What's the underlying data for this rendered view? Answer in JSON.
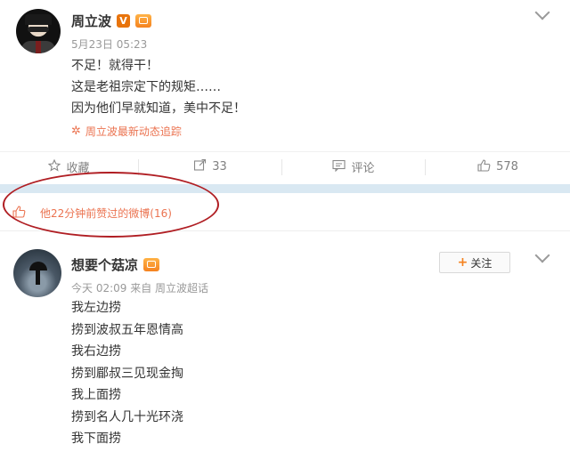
{
  "post1": {
    "author": "周立波",
    "time": "5月23日 05:23",
    "lines": [
      "不足！就得干！",
      "这是老祖宗定下的规矩……",
      "因为他们早就知道，美中不足！"
    ],
    "trace_link": "周立波最新动态追踪",
    "actions": {
      "favorite": "收藏",
      "repost": "33",
      "comment": "评论",
      "like": "578"
    }
  },
  "like_notice": "他22分钟前赞过的微博(16)",
  "post2": {
    "author": "想要个菇凉",
    "follow_label": "关注",
    "meta": "今天 02:09 来自 周立波超话",
    "lines": [
      "我左边捞",
      "捞到波叔五年恩情高",
      "我右边捞",
      "捞到郿叔三见现金掏",
      "我上面捞",
      "捞到名人几十光环浇",
      "我下面捞"
    ]
  },
  "colors": {
    "accent": "#eb7350",
    "highlight_ellipse": "#b01e23",
    "band": "#d9e8f2"
  }
}
